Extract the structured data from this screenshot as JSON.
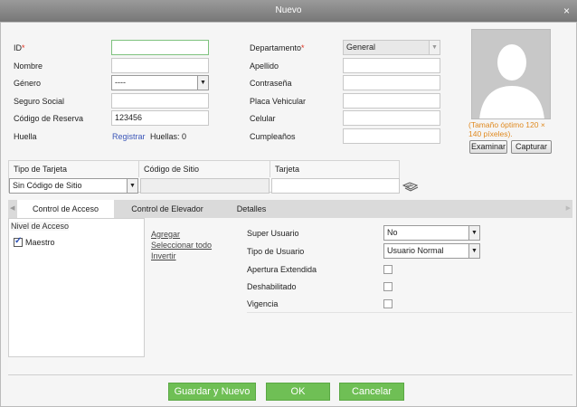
{
  "window": {
    "title": "Nuevo",
    "close_glyph": "×"
  },
  "form": {
    "id": {
      "label": "ID",
      "required_mark": "*",
      "value": ""
    },
    "nombre": {
      "label": "Nombre",
      "value": ""
    },
    "genero": {
      "label": "Género",
      "value": "----"
    },
    "seguro_social": {
      "label": "Seguro Social",
      "value": ""
    },
    "codigo_reserva": {
      "label": "Código de Reserva",
      "value": "123456"
    },
    "huella": {
      "label": "Huella",
      "link": "Registrar",
      "count_text": "Huellas: 0"
    },
    "departamento": {
      "label": "Departamento",
      "required_mark": "*",
      "value": "General"
    },
    "apellido": {
      "label": "Apellido",
      "value": ""
    },
    "contrasena": {
      "label": "Contraseña",
      "value": ""
    },
    "placa": {
      "label": "Placa Vehicular",
      "value": ""
    },
    "celular": {
      "label": "Celular",
      "value": ""
    },
    "cumpleanos": {
      "label": "Cumpleaños",
      "value": ""
    }
  },
  "photo": {
    "hint": "(Tamaño óptimo 120 × 140 píxeles).",
    "browse_label": "Examinar",
    "capture_label": "Capturar"
  },
  "card": {
    "headers": [
      "Tipo de Tarjeta",
      "Código de Sitio",
      "Tarjeta"
    ],
    "tipo_value": "Sin Código de Sitio",
    "codigo_value": "",
    "tarjeta_value": ""
  },
  "tabs": [
    {
      "label": "Control de Acceso",
      "active": true
    },
    {
      "label": "Control de Elevador",
      "active": false
    },
    {
      "label": "Detalles",
      "active": false
    }
  ],
  "access": {
    "nivel_title": "Nivel de Acceso",
    "levels": [
      {
        "label": "Maestro",
        "checked": true
      }
    ],
    "actions": {
      "add": "Agregar",
      "select_all": "Seleccionar todo",
      "invert": "Invertir"
    },
    "super_usuario": {
      "label": "Super Usuario",
      "value": "No"
    },
    "tipo_usuario": {
      "label": "Tipo de Usuario",
      "value": "Usuario Normal"
    },
    "apertura": {
      "label": "Apertura Extendida",
      "checked": false
    },
    "deshabilitado": {
      "label": "Deshabilitado",
      "checked": false
    },
    "vigencia": {
      "label": "Vigencia",
      "checked": false
    }
  },
  "footer": {
    "save_new": "Guardar y Nuevo",
    "ok": "OK",
    "cancel": "Cancelar"
  },
  "colors": {
    "accent_green": "#6fbf55",
    "title_bar": "#8a8a8a",
    "hint_orange": "#e08a20",
    "link_blue": "#3b56b8"
  }
}
